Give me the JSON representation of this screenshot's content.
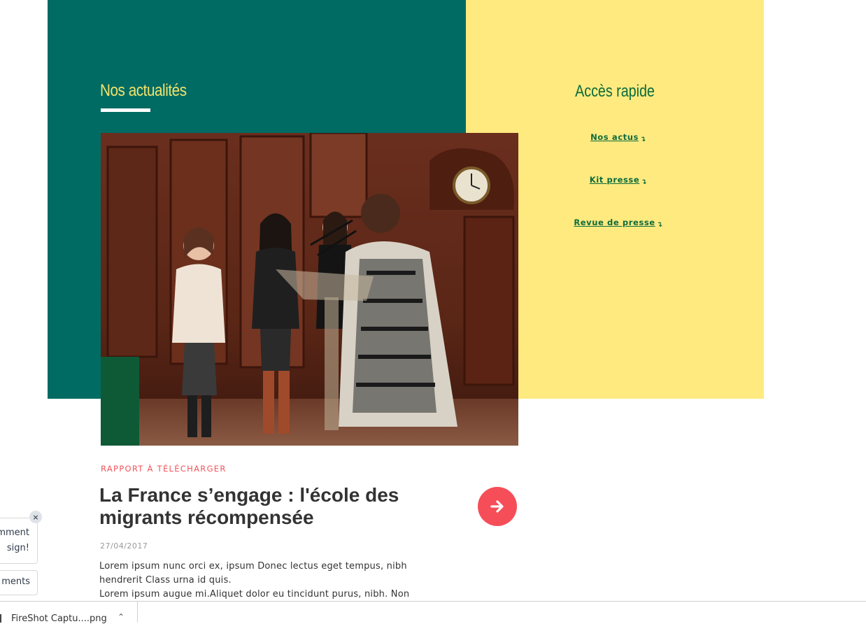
{
  "news": {
    "section_title": "Nos actualités",
    "kicker": "RAPPORT À TÉLÉCHARGER",
    "headline": "La France s’engage : l'école des migrants récompensée",
    "date": "27/04/2017",
    "excerpt_lines": [
      "Lorem ipsum nunc orci ex, ipsum Donec lectus eget tempus, nibh",
      "hendrerit Class urna id quis.",
      "Lorem ipsum augue mi.Aliquet dolor eu tincidunt purus, nibh. Non"
    ]
  },
  "quick_access": {
    "title": "Accès rapide",
    "links": [
      {
        "label": "Nos actus",
        "arrow": "↴"
      },
      {
        "label": "Kit presse",
        "arrow": "↴"
      },
      {
        "label": "Revue de presse",
        "arrow": "↴"
      }
    ]
  },
  "feedback_widget": {
    "line1": "mment",
    "line2": "sign!",
    "close": "×",
    "comments_button": "ments"
  },
  "download_bar": {
    "file_name": "FireShot Captu....png",
    "caret": "⌃"
  },
  "colors": {
    "green_panel": "#006b63",
    "yellow_panel": "#ffea80",
    "accent_red": "#f54e59",
    "title_yellow": "#f2e36b",
    "link_green": "#0b6b3c"
  },
  "icons": {
    "arrow_button": "arrow-right-icon",
    "popup_close": "close-icon",
    "download_caret": "chevron-up-icon"
  }
}
